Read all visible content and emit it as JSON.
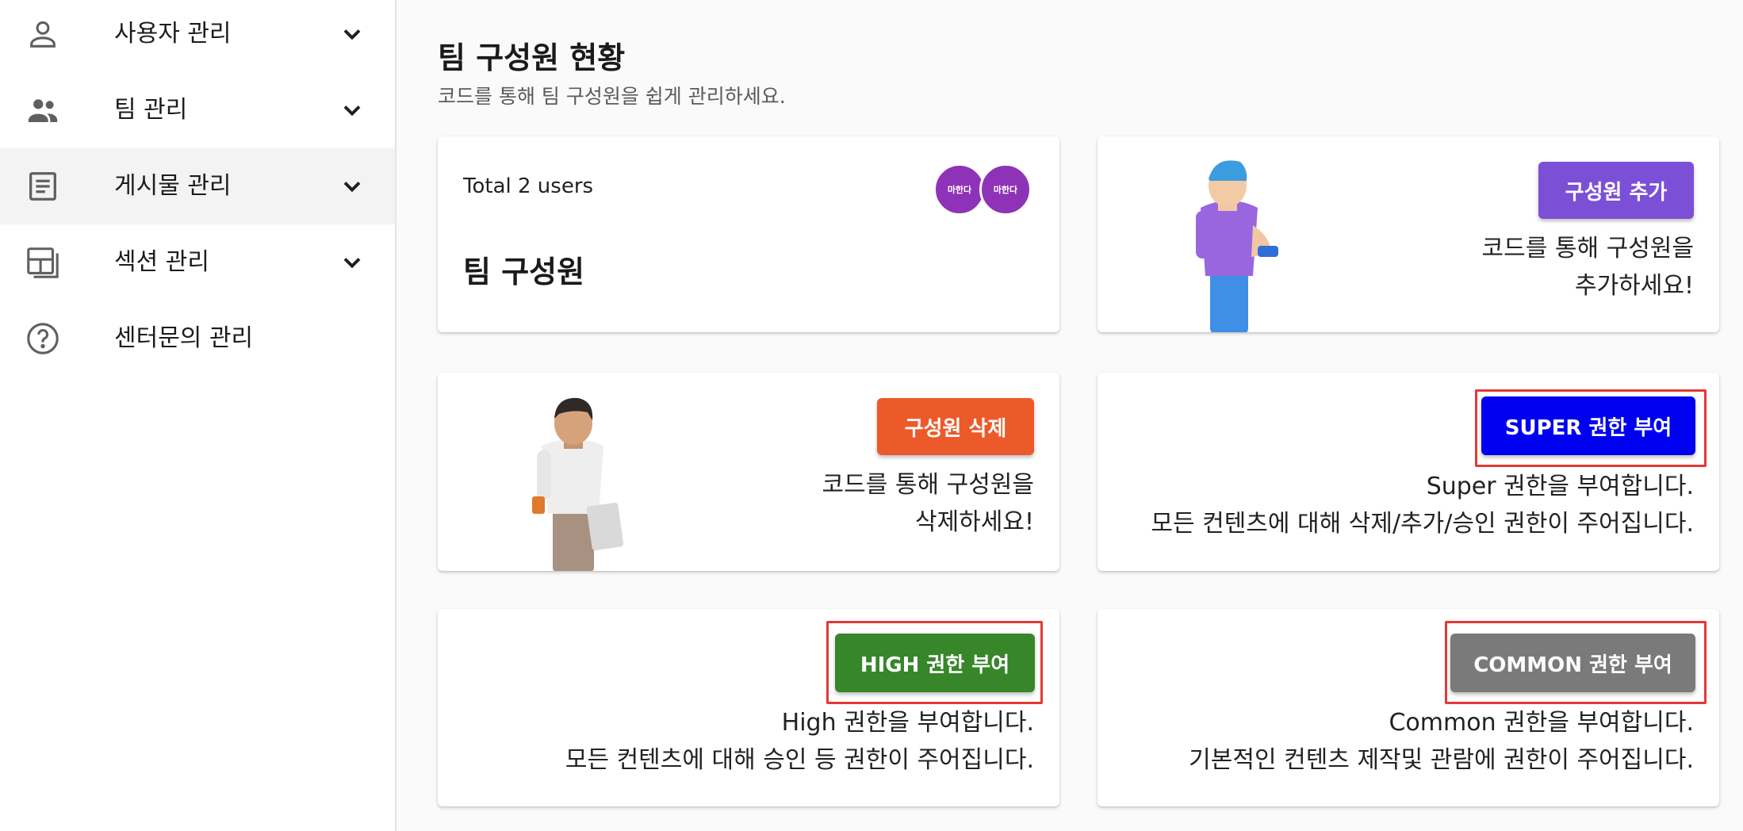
{
  "sidebar": {
    "items": [
      {
        "label": "사용자 관리",
        "icon": "person-icon",
        "expandable": true,
        "active": false
      },
      {
        "label": "팀 관리",
        "icon": "group-icon",
        "expandable": true,
        "active": false
      },
      {
        "label": "게시물 관리",
        "icon": "article-icon",
        "expandable": true,
        "active": true
      },
      {
        "label": "섹션 관리",
        "icon": "layout-icon",
        "expandable": true,
        "active": false
      },
      {
        "label": "센터문의 관리",
        "icon": "help-circle-icon",
        "expandable": false,
        "active": false
      }
    ]
  },
  "main": {
    "title": "팀 구성원 현황",
    "subtitle": "코드를 통해 팀 구성원을 쉽게 관리하세요."
  },
  "cards": {
    "members": {
      "total_label": "Total 2 users",
      "title": "팀 구성원",
      "avatar_text": "마한다",
      "avatar_color": "#8e33b8"
    },
    "add": {
      "button_label": "구성원 추가",
      "button_color": "#7b4fd6",
      "line1": "코드를 통해 구성원을",
      "line2": "추가하세요!"
    },
    "remove": {
      "button_label": "구성원 삭제",
      "button_color": "#ec5a2a",
      "line1": "코드를 통해 구성원을",
      "line2": "삭제하세요!"
    },
    "super": {
      "button_label": "SUPER 권한 부여",
      "button_color": "#0000f0",
      "line1": "Super 권한을 부여합니다.",
      "line2": "모든 컨텐츠에 대해 삭제/추가/승인 권한이 주어집니다."
    },
    "high": {
      "button_label": "HIGH 권한 부여",
      "button_color": "#37862a",
      "line1": "High 권한을 부여합니다.",
      "line2": "모든 컨텐츠에 대해 승인 등 권한이 주어집니다."
    },
    "common": {
      "button_label": "COMMON 권한 부여",
      "button_color": "#7a7a7a",
      "line1": "Common 권한을 부여합니다.",
      "line2": "기본적인 컨텐츠 제작및 관람에 권한이 주어집니다."
    }
  },
  "colors": {
    "highlight": "#e53935"
  }
}
